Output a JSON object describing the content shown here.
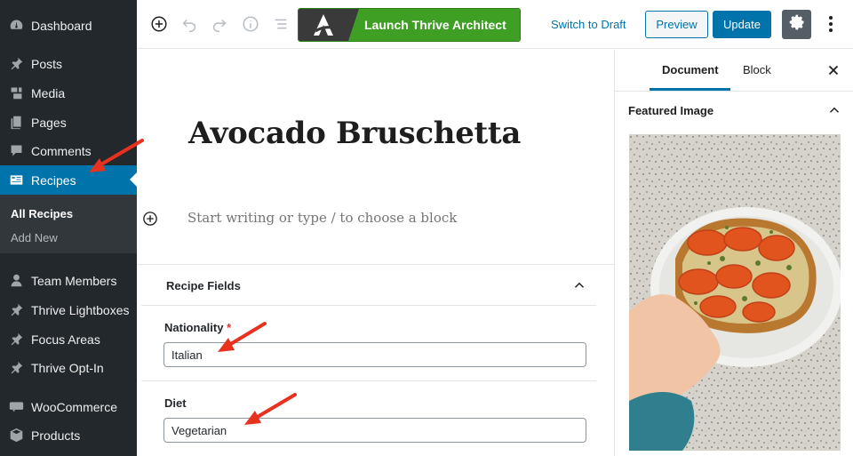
{
  "sidebar": {
    "items": [
      {
        "label": "Dashboard",
        "icon": "dashboard-icon"
      },
      {
        "label": "Posts",
        "icon": "pin-icon"
      },
      {
        "label": "Media",
        "icon": "media-icon"
      },
      {
        "label": "Pages",
        "icon": "pages-icon"
      },
      {
        "label": "Comments",
        "icon": "comment-icon"
      },
      {
        "label": "Recipes",
        "icon": "recipes-icon"
      },
      {
        "label": "Team Members",
        "icon": "user-icon"
      },
      {
        "label": "Thrive Lightboxes",
        "icon": "pin-icon"
      },
      {
        "label": "Focus Areas",
        "icon": "pin-icon"
      },
      {
        "label": "Thrive Opt-In",
        "icon": "pin-icon"
      },
      {
        "label": "WooCommerce",
        "icon": "woocommerce-icon"
      },
      {
        "label": "Products",
        "icon": "products-icon"
      }
    ],
    "active": "Recipes",
    "submenu": [
      "All Recipes",
      "Add New"
    ]
  },
  "toolbar": {
    "launch_label": "Launch Thrive Architect",
    "switch_draft": "Switch to Draft",
    "preview": "Preview",
    "update": "Update"
  },
  "editor": {
    "title": "Avocado Bruschetta",
    "placeholder": "Start writing or type / to choose a block"
  },
  "recipe_fields": {
    "heading": "Recipe Fields",
    "nationality_label": "Nationality",
    "required_mark": "*",
    "nationality_value": "Italian",
    "diet_label": "Diet",
    "diet_value": "Vegetarian"
  },
  "panel": {
    "tab_document": "Document",
    "tab_block": "Block",
    "featured_image": "Featured Image"
  },
  "colors": {
    "sidebar_bg": "#23282d",
    "accent": "#0073aa",
    "launch_green": "#3f9e24",
    "arrow_red": "#e8321f"
  }
}
